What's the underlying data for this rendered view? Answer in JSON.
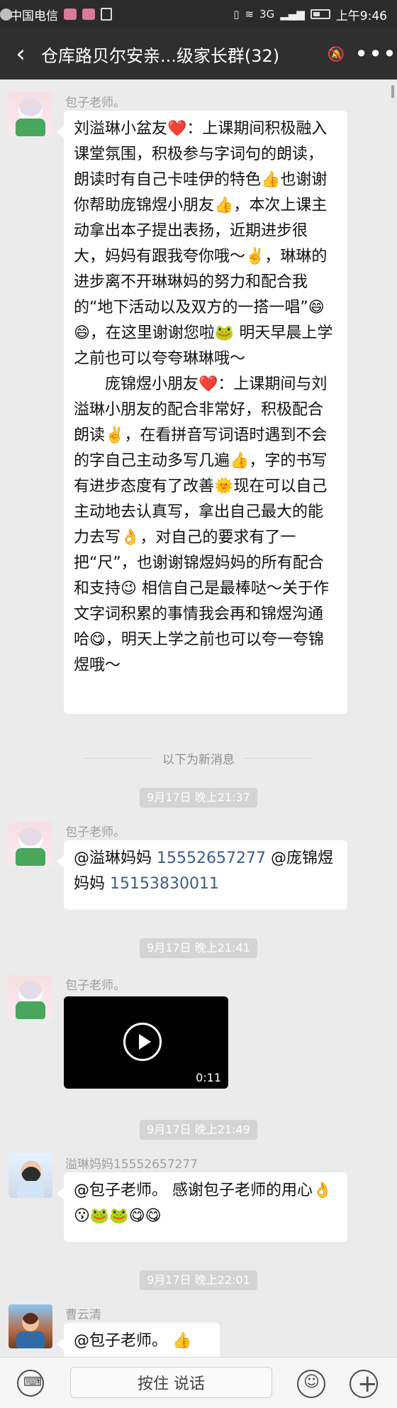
{
  "status_bar": {
    "carrier": "中国电信",
    "mini_signal": "3G",
    "time": "上午9:46"
  },
  "header": {
    "title": "仓库路贝尔安亲...级家长群(32)"
  },
  "messages": [
    {
      "sender": "包子老师。",
      "paragraphs": [
        "刘溢琳小盆友❤️：上课期间积极融入课堂氛围，积极参与字词句的朗读，朗读时有自己卡哇伊的特色👍也谢谢你帮助庞锦煜小朋友👍，本次上课主动拿出本子提出表扬，近期进步很大，妈妈有跟我夸你哦～✌️，琳琳的进步离不开琳琳妈的努力和配合我的“地下活动以及双方的一搭一唱”😄😄，在这里谢谢您啦🐸 明天早晨上学之前也可以夸夸琳琳哦～",
        "庞锦煜小朋友❤️：上课期间与刘溢琳小朋友的配合非常好，积极配合朗读✌️，在看拼音写词语时遇到不会的字自己主动多写几遍👍，字的书写有进步态度有了改善🌞现在可以自己主动地去认真写，拿出自己最大的能力去写👌，对自己的要求有了一把“尺”，也谢谢锦煜妈妈的所有配合和支持😉 相信自己是最棒哒～关于作文字词积累的事情我会再和锦煜沟通哈😋，明天上学之前也可以夸一夸锦煜哦～"
      ]
    },
    {
      "sender": "包子老师。",
      "text_1": "@溢琳妈妈 ",
      "phone_1": "15552657277",
      "text_2": " @庞锦煜妈妈 ",
      "phone_2": "15153830011"
    },
    {
      "sender": "包子老师。",
      "video_duration": "0:11"
    },
    {
      "sender": "溢琳妈妈15552657277",
      "text": "@包子老师。 感谢包子老师的用心👌😗🐸🐸😋😋"
    },
    {
      "sender": "曹云清",
      "text": "@包子老师。 👍"
    }
  ],
  "system": {
    "new_messages": "以下为新消息"
  },
  "timestamps": [
    "9月17日 晚上21:37",
    "9月17日 晚上21:41",
    "9月17日 晚上21:49",
    "9月17日 晚上22:01"
  ],
  "bottom_bar": {
    "hold_to_talk": "按住 说话"
  }
}
